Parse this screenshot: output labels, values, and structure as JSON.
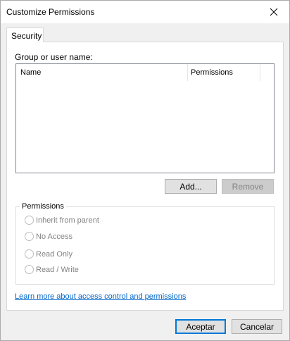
{
  "window": {
    "title": "Customize Permissions"
  },
  "tabs": [
    {
      "label": "Security"
    }
  ],
  "security": {
    "group_label": "Group or user name:",
    "columns": [
      "Name",
      "Permissions"
    ],
    "rows": [],
    "add_label": "Add...",
    "remove_label": "Remove",
    "permissions_title": "Permissions",
    "options": [
      {
        "label": "Inherit from parent",
        "enabled": false,
        "checked": false
      },
      {
        "label": "No Access",
        "enabled": false,
        "checked": false
      },
      {
        "label": "Read Only",
        "enabled": false,
        "checked": false
      },
      {
        "label": "Read / Write",
        "enabled": false,
        "checked": false
      }
    ],
    "help_link": "Learn more about access control and permissions"
  },
  "footer": {
    "ok_label": "Aceptar",
    "cancel_label": "Cancelar"
  },
  "colors": {
    "accent": "#0078d7",
    "link": "#0066cc",
    "disabled_text": "#838383"
  },
  "icons": {
    "close": "close-icon",
    "radio": "radio-circle-icon"
  }
}
